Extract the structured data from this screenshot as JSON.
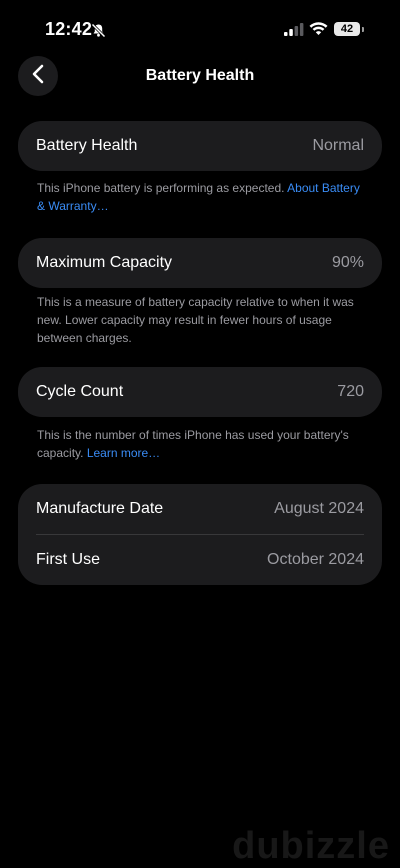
{
  "status_bar": {
    "time": "12:42",
    "battery_level": "42"
  },
  "nav": {
    "title": "Battery Health"
  },
  "battery_health": {
    "label": "Battery Health",
    "value": "Normal",
    "note": "This iPhone battery is performing as expected.",
    "link": "About Battery & Warranty…"
  },
  "maximum_capacity": {
    "label": "Maximum Capacity",
    "value": "90%",
    "note": "This is a measure of battery capacity relative to when it was new. Lower capacity may result in fewer hours of usage between charges."
  },
  "cycle_count": {
    "label": "Cycle Count",
    "value": "720",
    "note": "This is the number of times iPhone has used your battery's capacity.",
    "link": "Learn more…"
  },
  "dates": {
    "manufacture_label": "Manufacture Date",
    "manufacture_value": "August 2024",
    "first_use_label": "First Use",
    "first_use_value": "October 2024"
  },
  "watermark": "dubizzle",
  "colors": {
    "background": "#000000",
    "card": "#1c1c1e",
    "secondary_text": "#9b9ba1",
    "link": "#3a8cf5"
  }
}
